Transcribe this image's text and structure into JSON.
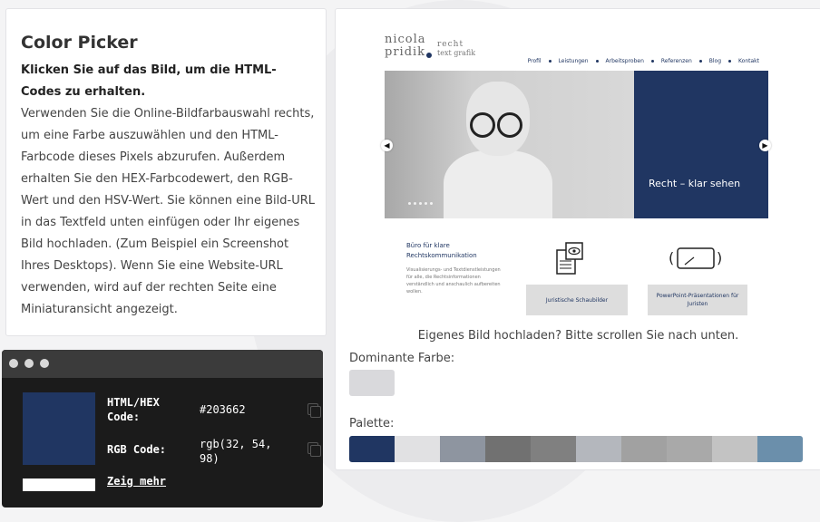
{
  "picker": {
    "title": "Color Picker",
    "instruction": "Klicken Sie auf das Bild, um die HTML-Codes zu erhalten.",
    "description": "Verwenden Sie die Online-Bildfarbauswahl rechts, um eine Farbe auszuwählen und den HTML-Farbcode dieses Pixels abzurufen. Außerdem erhalten Sie den HEX-Farbcodewert, den RGB-Wert und den HSV-Wert. Sie können eine Bild-URL in das Textfeld unten einfügen oder Ihr eigenes Bild hochladen. (Zum Beispiel ein Screenshot Ihres Desktops). Wenn Sie eine Website-URL verwenden, wird auf der rechten Seite eine Miniaturansicht angezeigt."
  },
  "preview": {
    "logo_name1": "nicola",
    "logo_name2": "pridik",
    "logo_right1": "recht",
    "logo_right2": "text grafik",
    "nav": [
      "Profil",
      "Leistungen",
      "Arbeitsproben",
      "Referenzen",
      "Blog",
      "Kontakt"
    ],
    "hero_text": "Recht – klar sehen",
    "sub_title": "Büro für klare Rechtskommunikation",
    "sub_text": "Visualisierungs- und Textdienstleistungen für alle, die Rechtsinformationen verständlich und anschaulich aufbereiten wollen.",
    "btn1": "Juristische Schaubilder",
    "btn2": "PowerPoint-Präsentationen für Juristen"
  },
  "upload_note": "Eigenes Bild hochladen? Bitte scrollen Sie nach unten.",
  "dominant": {
    "label": "Dominante Farbe:",
    "color": "#d9d9dc"
  },
  "palette": {
    "label": "Palette:",
    "colors": [
      "#203662",
      "#e1e1e3",
      "#8e95a0",
      "#717171",
      "#808080",
      "#b4b7bd",
      "#a1a1a1",
      "#a9a9a9",
      "#c3c3c3",
      "#6b8fab"
    ]
  },
  "result": {
    "hex_label": "HTML/HEX Code:",
    "hex_value": "#203662",
    "rgb_label": "RGB Code:",
    "rgb_value": "rgb(32, 54, 98)",
    "more_link": "Zeig mehr",
    "selected_color": "#203662"
  }
}
